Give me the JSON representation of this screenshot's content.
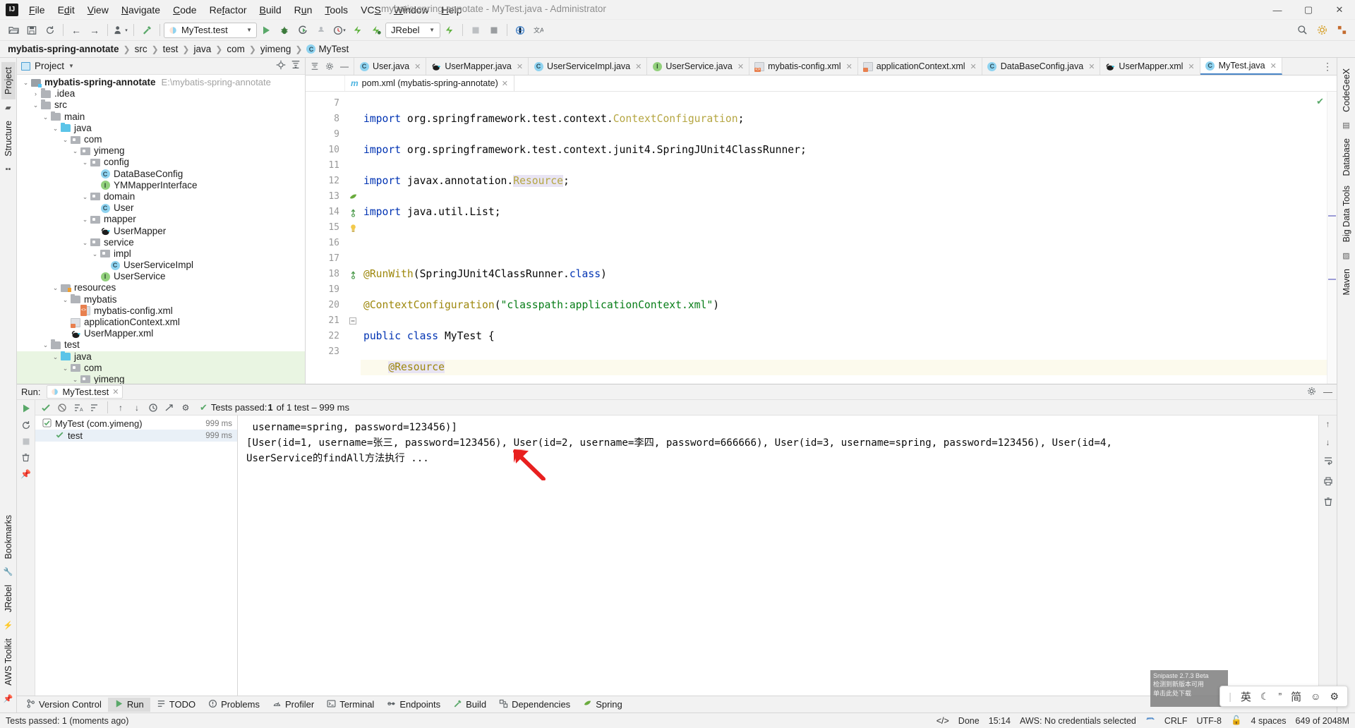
{
  "window": {
    "title": "mybatis-spring-annotate - MyTest.java - Administrator",
    "minimize": "—",
    "maximize": "▢",
    "close": "✕"
  },
  "menubar": [
    "File",
    "Edit",
    "View",
    "Navigate",
    "Code",
    "Refactor",
    "Build",
    "Run",
    "Tools",
    "VCS",
    "Window",
    "Help"
  ],
  "toolbar": {
    "open_icon": "open-folder-icon",
    "save_icon": "save-icon",
    "sync_icon": "sync-icon",
    "back_icon": "back-arrow-icon",
    "forward_icon": "forward-arrow-icon",
    "profile_icon": "user-profile-icon",
    "build_icon": "hammer-icon",
    "run_config": "MyTest.test",
    "run_icon": "run-icon",
    "debug_icon": "debug-icon",
    "coverage_icon": "run-coverage-icon",
    "profiler_icon": "profiler-icon",
    "clock_icon": "clock-icon",
    "jrebel_run_icon": "jrebel-run-icon",
    "jrebel_debug_icon": "jrebel-debug-icon",
    "jrebel_label": "JRebel",
    "stop_icon": "stop-icon",
    "browser_icon": "browser-icon",
    "translate_icon": "translate-icon",
    "search_icon": "search-icon",
    "settings_icon": "gear-icon",
    "structure_icon": "structure-icon"
  },
  "breadcrumb": {
    "items": [
      "mybatis-spring-annotate",
      "src",
      "test",
      "java",
      "com",
      "yimeng",
      "MyTest"
    ]
  },
  "left_strip": {
    "project_tab": "Project",
    "structure_tab": "Structure",
    "bookmarks_tab": "Bookmarks",
    "jrebel_tab": "JRebel",
    "aws_tab": "AWS Toolkit"
  },
  "right_strip": {
    "codegeex_tab": "CodeGeeX",
    "database_tab": "Database",
    "bigdata_tab": "Big Data Tools",
    "maven_tab": "Maven"
  },
  "project_panel": {
    "title": "Project",
    "locate_icon": "locate-icon",
    "collapse_icon": "collapse-all-icon",
    "tree": [
      {
        "depth": 0,
        "twisty": "v",
        "icon": "module",
        "label": "mybatis-spring-annotate",
        "bold": true,
        "path": "E:\\mybatis-spring-annotate"
      },
      {
        "depth": 1,
        "twisty": ">",
        "icon": "folder",
        "label": ".idea"
      },
      {
        "depth": 1,
        "twisty": "v",
        "icon": "folder",
        "label": "src"
      },
      {
        "depth": 2,
        "twisty": "v",
        "icon": "folder",
        "label": "main"
      },
      {
        "depth": 3,
        "twisty": "v",
        "icon": "source",
        "label": "java"
      },
      {
        "depth": 4,
        "twisty": "v",
        "icon": "package",
        "label": "com"
      },
      {
        "depth": 5,
        "twisty": "v",
        "icon": "package",
        "label": "yimeng"
      },
      {
        "depth": 6,
        "twisty": "v",
        "icon": "package",
        "label": "config"
      },
      {
        "depth": 7,
        "twisty": "",
        "icon": "class",
        "label": "DataBaseConfig"
      },
      {
        "depth": 7,
        "twisty": "",
        "icon": "interface",
        "label": "YMMapperInterface"
      },
      {
        "depth": 6,
        "twisty": "v",
        "icon": "package",
        "label": "domain"
      },
      {
        "depth": 7,
        "twisty": "",
        "icon": "class",
        "label": "User"
      },
      {
        "depth": 6,
        "twisty": "v",
        "icon": "package",
        "label": "mapper"
      },
      {
        "depth": 7,
        "twisty": "",
        "icon": "mybatis",
        "label": "UserMapper"
      },
      {
        "depth": 6,
        "twisty": "v",
        "icon": "package",
        "label": "service"
      },
      {
        "depth": 7,
        "twisty": "v",
        "icon": "package",
        "label": "impl"
      },
      {
        "depth": 8,
        "twisty": "",
        "icon": "class",
        "label": "UserServiceImpl"
      },
      {
        "depth": 7,
        "twisty": "",
        "icon": "interface",
        "label": "UserService"
      },
      {
        "depth": 3,
        "twisty": "v",
        "icon": "resources",
        "label": "resources"
      },
      {
        "depth": 4,
        "twisty": "v",
        "icon": "folder",
        "label": "mybatis"
      },
      {
        "depth": 5,
        "twisty": "",
        "icon": "xml",
        "label": "mybatis-config.xml"
      },
      {
        "depth": 4,
        "twisty": "",
        "icon": "xml2",
        "label": "applicationContext.xml"
      },
      {
        "depth": 4,
        "twisty": "",
        "icon": "mybatis",
        "label": "UserMapper.xml"
      },
      {
        "depth": 2,
        "twisty": "v",
        "icon": "folder",
        "label": "test",
        "selected": false
      },
      {
        "depth": 3,
        "twisty": "v",
        "icon": "source",
        "label": "java",
        "selected": true
      },
      {
        "depth": 4,
        "twisty": "v",
        "icon": "package",
        "label": "com",
        "selected": true
      },
      {
        "depth": 5,
        "twisty": "v",
        "icon": "package",
        "label": "yimeng",
        "selected": true
      }
    ]
  },
  "editor": {
    "tabs": [
      {
        "label": "User.java",
        "icon": "class",
        "active": false
      },
      {
        "label": "UserMapper.java",
        "icon": "mybatis",
        "active": false
      },
      {
        "label": "UserServiceImpl.java",
        "icon": "class",
        "active": false
      },
      {
        "label": "UserService.java",
        "icon": "interface",
        "active": false
      },
      {
        "label": "mybatis-config.xml",
        "icon": "xml",
        "active": false
      },
      {
        "label": "applicationContext.xml",
        "icon": "xml2",
        "active": false
      },
      {
        "label": "DataBaseConfig.java",
        "icon": "class",
        "active": false
      },
      {
        "label": "UserMapper.xml",
        "icon": "mybatis",
        "active": false
      },
      {
        "label": "MyTest.java",
        "icon": "class",
        "active": true
      }
    ],
    "subtab": "pom.xml (mybatis-spring-annotate)",
    "subtab_icon": "maven-icon",
    "more_tabs_icon": "more-tabs-icon",
    "lines": [
      {
        "no": 7,
        "gutter": "",
        "highlight": false
      },
      {
        "no": 8,
        "gutter": "",
        "highlight": false
      },
      {
        "no": 9,
        "gutter": "",
        "highlight": false
      },
      {
        "no": 10,
        "gutter": "",
        "highlight": false
      },
      {
        "no": 11,
        "gutter": "",
        "highlight": false
      },
      {
        "no": 12,
        "gutter": "",
        "highlight": false
      },
      {
        "no": 13,
        "gutter": "spring-bean",
        "highlight": false
      },
      {
        "no": 14,
        "gutter": "override",
        "highlight": false
      },
      {
        "no": 15,
        "gutter": "bulb",
        "highlight": true
      },
      {
        "no": 16,
        "gutter": "",
        "highlight": false
      },
      {
        "no": 17,
        "gutter": "",
        "highlight": false
      },
      {
        "no": 18,
        "gutter": "override",
        "highlight": false
      },
      {
        "no": 19,
        "gutter": "",
        "highlight": false
      },
      {
        "no": 20,
        "gutter": "",
        "highlight": false
      },
      {
        "no": 21,
        "gutter": "fold",
        "highlight": false
      },
      {
        "no": 22,
        "gutter": "",
        "highlight": false
      },
      {
        "no": 23,
        "gutter": "",
        "highlight": false
      }
    ],
    "inspection_ok_icon": "inspection-ok-icon"
  },
  "run_panel": {
    "label": "Run:",
    "tab_label": "MyTest.test",
    "tab_icon": "run-config-icon",
    "settings_icon": "gear-icon",
    "hide_icon": "hide-icon",
    "toolbar": {
      "rerun_ok_icon": "rerun-tests-icon",
      "toggle_ignored_icon": "ignored-tests-icon",
      "sort_alpha_icon": "sort-alphabetically-icon",
      "sort_duration_icon": "sort-duration-icon",
      "expand_icon": "expand-all-icon",
      "prev_icon": "prev-test-icon",
      "next_icon": "next-test-icon",
      "history_icon": "test-history-icon",
      "export_icon": "export-icon"
    },
    "status": {
      "prefix": "Tests passed: ",
      "count": "1",
      "suffix": " of 1 test – 999 ms"
    },
    "tree": [
      {
        "label": "MyTest (com.yimeng)",
        "time": "999 ms",
        "depth": 0,
        "selected": false,
        "icon": "test-passed-icon"
      },
      {
        "label": "test",
        "time": "999 ms",
        "depth": 1,
        "selected": true,
        "icon": "test-passed-icon"
      }
    ],
    "console_lines": [
      "UserService的findAll方法执行 ...",
      "[User(id=1, username=张三, password=123456), User(id=2, username=李四, password=666666), User(id=3, username=spring, password=123456), User(id=4,",
      " username=spring, password=123456)]"
    ],
    "side_tools": {
      "up_icon": "scroll-up-icon",
      "down_icon": "scroll-down-icon",
      "wrap_icon": "soft-wrap-icon",
      "print_icon": "print-icon",
      "trash_icon": "clear-all-icon"
    }
  },
  "bottom_strip": [
    {
      "label": "Version Control",
      "icon": "version-control-icon",
      "active": false
    },
    {
      "label": "Run",
      "icon": "run-icon",
      "active": true
    },
    {
      "label": "TODO",
      "icon": "todo-icon",
      "active": false
    },
    {
      "label": "Problems",
      "icon": "problems-icon",
      "active": false
    },
    {
      "label": "Profiler",
      "icon": "profiler-icon",
      "active": false
    },
    {
      "label": "Terminal",
      "icon": "terminal-icon",
      "active": false
    },
    {
      "label": "Endpoints",
      "icon": "endpoints-icon",
      "active": false
    },
    {
      "label": "Build",
      "icon": "build-icon",
      "active": false
    },
    {
      "label": "Dependencies",
      "icon": "dependencies-icon",
      "active": false
    },
    {
      "label": "Spring",
      "icon": "spring-icon",
      "active": false
    }
  ],
  "statusbar": {
    "left": "Tests passed: 1 (moments ago)",
    "done": "Done",
    "time": "15:14",
    "aws": "AWS: No credentials selected",
    "aws_icon": "aws-icon",
    "line_sep": "CRLF",
    "encoding": "UTF-8",
    "indent": "4 spaces",
    "memory": "649 of 2048M",
    "lock_icon": "lock-icon",
    "done_icon": "done-icon"
  },
  "ime": {
    "mode": "英",
    "moon_icon": "moon-icon",
    "quote_icon": "quote-icon",
    "simplified": "简",
    "emoji_icon": "emoji-icon",
    "settings_icon": "ime-settings-icon"
  },
  "snipaste": {
    "title": "Snipaste 2.7.3 Beta",
    "line1": "检测到新版本可用",
    "line2": "单击此处下载"
  },
  "colors": {
    "accent": "#4a86c8",
    "green": "#59a869",
    "selection": "#e9f5e2",
    "keyword": "#0033b3",
    "string": "#067d17",
    "annotation": "#9e880d",
    "field": "#871094"
  }
}
